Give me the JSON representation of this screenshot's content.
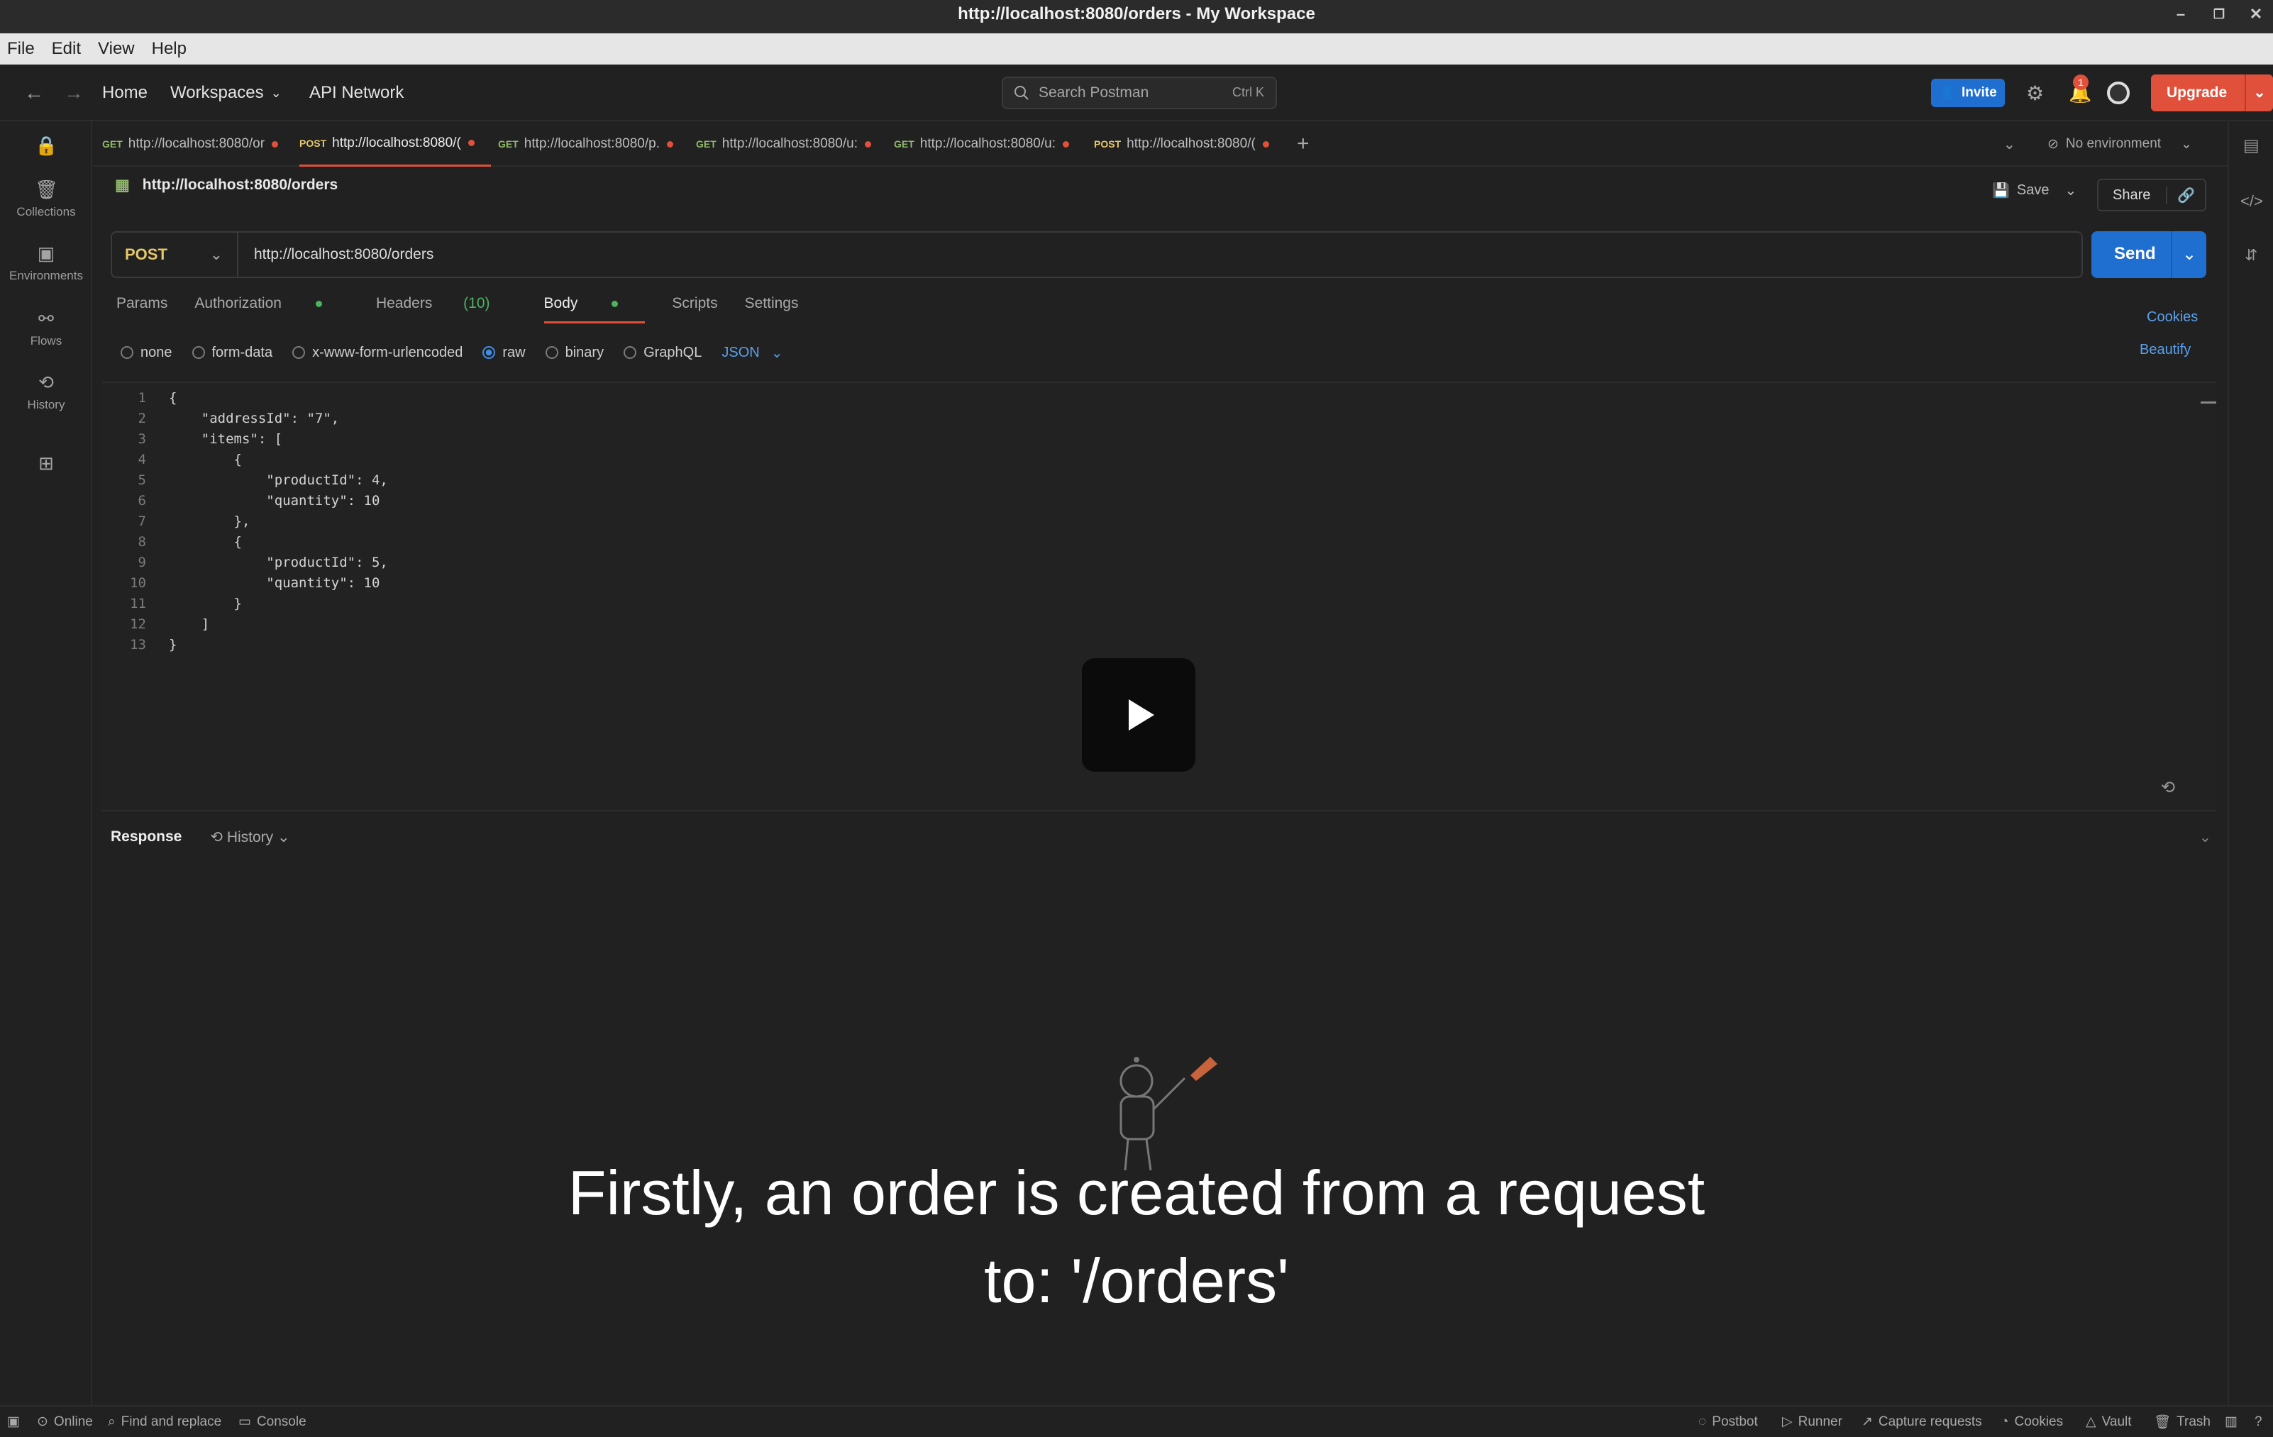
{
  "window": {
    "title": "http://localhost:8080/orders - My Workspace"
  },
  "menu": [
    "File",
    "Edit",
    "View",
    "Help"
  ],
  "header": {
    "home": "Home",
    "workspaces": "Workspaces",
    "api_network": "API Network",
    "search_placeholder": "Search Postman",
    "search_shortcut": "Ctrl  K",
    "invite": "Invite",
    "upgrade": "Upgrade",
    "notification_count": "1"
  },
  "sidebar": {
    "items": [
      {
        "label": "Collections",
        "icon": "collections-icon"
      },
      {
        "label": "Environments",
        "icon": "environments-icon"
      },
      {
        "label": "Flows",
        "icon": "flows-icon"
      },
      {
        "label": "History",
        "icon": "history-icon"
      }
    ]
  },
  "tabs": [
    {
      "method": "GET",
      "label": "http://localhost:8080/or"
    },
    {
      "method": "POST",
      "label": "http://localhost:8080/("
    },
    {
      "method": "GET",
      "label": "http://localhost:8080/p."
    },
    {
      "method": "GET",
      "label": "http://localhost:8080/u:"
    },
    {
      "method": "GET",
      "label": "http://localhost:8080/u:"
    },
    {
      "method": "POST",
      "label": "http://localhost:8080/("
    }
  ],
  "environment": "No environment",
  "request": {
    "title": "http://localhost:8080/orders",
    "save": "Save",
    "share": "Share",
    "method": "POST",
    "url": "http://localhost:8080/orders",
    "send": "Send",
    "tabs": [
      "Params",
      "Authorization",
      "Headers",
      "(10)",
      "Body",
      "Scripts",
      "Settings"
    ],
    "cookies": "Cookies",
    "beautify": "Beautify",
    "body_options": [
      "none",
      "form-data",
      "x-www-form-urlencoded",
      "raw",
      "binary",
      "GraphQL"
    ],
    "body_format": "JSON"
  },
  "code_lines": [
    "{",
    "    \"addressId\": \"7\",",
    "    \"items\": [",
    "        {",
    "            \"productId\": 4,",
    "            \"quantity\": 10",
    "        },",
    "        {",
    "            \"productId\": 5,",
    "            \"quantity\": 10",
    "        }",
    "    ]",
    "}"
  ],
  "line_numbers": [
    "1",
    "2",
    "3",
    "4",
    "5",
    "6",
    "7",
    "8",
    "9",
    "10",
    "11",
    "12",
    "13"
  ],
  "response": {
    "label": "Response",
    "history": "History"
  },
  "caption": {
    "line1": "Firstly, an order is created from a request",
    "line2": "to: '/orders'"
  },
  "statusbar": {
    "online": "Online",
    "find_replace": "Find and replace",
    "console": "Console",
    "postbot": "Postbot",
    "runner": "Runner",
    "capture": "Capture requests",
    "cookies": "Cookies",
    "vault": "Vault",
    "trash": "Trash"
  },
  "colors": {
    "accent": "#1f6fd1",
    "upgrade": "#e0503a",
    "post": "#e6c86a",
    "get": "#8fb86a"
  }
}
